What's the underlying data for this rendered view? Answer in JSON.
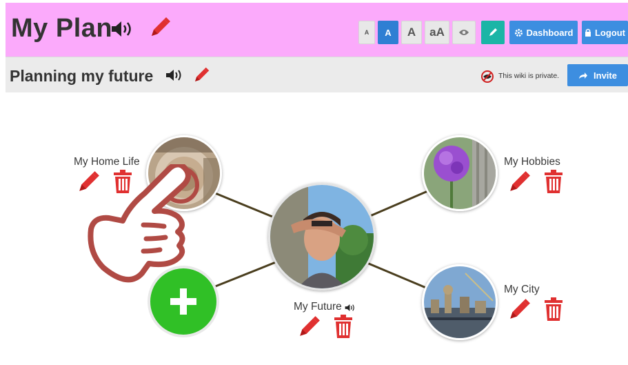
{
  "header": {
    "title": "My Plan",
    "text_size_buttons": [
      "A",
      "A",
      "A",
      "aA"
    ],
    "dashboard_label": "Dashboard",
    "logout_label": "Logout"
  },
  "subheader": {
    "title": "Planning my future",
    "privacy_text": "This wiki is private.",
    "invite_label": "Invite"
  },
  "map": {
    "center": {
      "label": "My Future"
    },
    "nodes": [
      {
        "label": "My Home Life"
      },
      {
        "label": "My Hobbies"
      },
      {
        "label": "My City"
      }
    ]
  },
  "colors": {
    "header_bg": "#fbaafb",
    "subheader_bg": "#ebebeb",
    "accent_blue": "#3d8ee0",
    "edit_red": "#e03030",
    "add_green": "#30c026",
    "teal": "#1bb5a6"
  },
  "icons": [
    "speaker-icon",
    "pencil-icon",
    "eye-icon",
    "trash-icon",
    "plus-icon",
    "gear-icon",
    "lock-icon",
    "share-arrow-icon",
    "private-eye-icon",
    "pointing-hand-icon"
  ]
}
